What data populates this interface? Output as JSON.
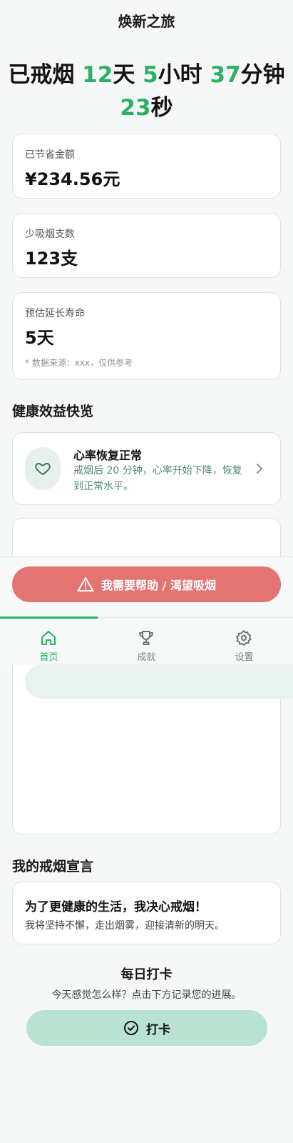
{
  "app": {
    "title": "焕新之旅"
  },
  "timer": {
    "prefix": "已戒烟",
    "days": "12",
    "days_unit": "天",
    "hours": "5",
    "hours_unit": "小时",
    "minutes": "37",
    "minutes_unit": "分钟",
    "seconds": "23",
    "seconds_unit": "秒"
  },
  "stats": {
    "savings": {
      "label": "已节省金额",
      "value": "¥234.56元"
    },
    "cigarettes": {
      "label": "少吸烟支数",
      "value": "123支"
    },
    "lifespan": {
      "label": "预估延长寿命",
      "value": "5天",
      "note": "* 数据来源：xxx，仅供参考"
    }
  },
  "health": {
    "section_title": "健康效益快览",
    "items": [
      {
        "icon": "heart-icon",
        "title": "心率恢复正常",
        "desc": "戒烟后 20 分钟，心率开始下降，恢复到正常水平。"
      }
    ]
  },
  "help_button": {
    "label": "我需要帮助 / 渴望吸烟",
    "icon": "warning-icon"
  },
  "tabs": [
    {
      "label": "首页",
      "icon": "home-icon",
      "active": true
    },
    {
      "label": "成就",
      "icon": "trophy-icon",
      "active": false
    },
    {
      "label": "设置",
      "icon": "gear-icon",
      "active": false
    }
  ],
  "declaration": {
    "section_title": "我的戒烟宣言",
    "title": "为了更健康的生活，我决心戒烟！",
    "text": "我将坚持不懈，走出烟雾，迎接清新的明天。"
  },
  "checkin": {
    "title": "每日打卡",
    "subtitle": "今天感觉怎么样？点击下方记录您的进展。",
    "button_label": "打卡",
    "icon": "check-circle-icon"
  },
  "colors": {
    "accent": "#2bb066",
    "help_button": "#e47474",
    "checkin_button": "#b8e3d2",
    "benefit_text": "#4f8a72"
  }
}
